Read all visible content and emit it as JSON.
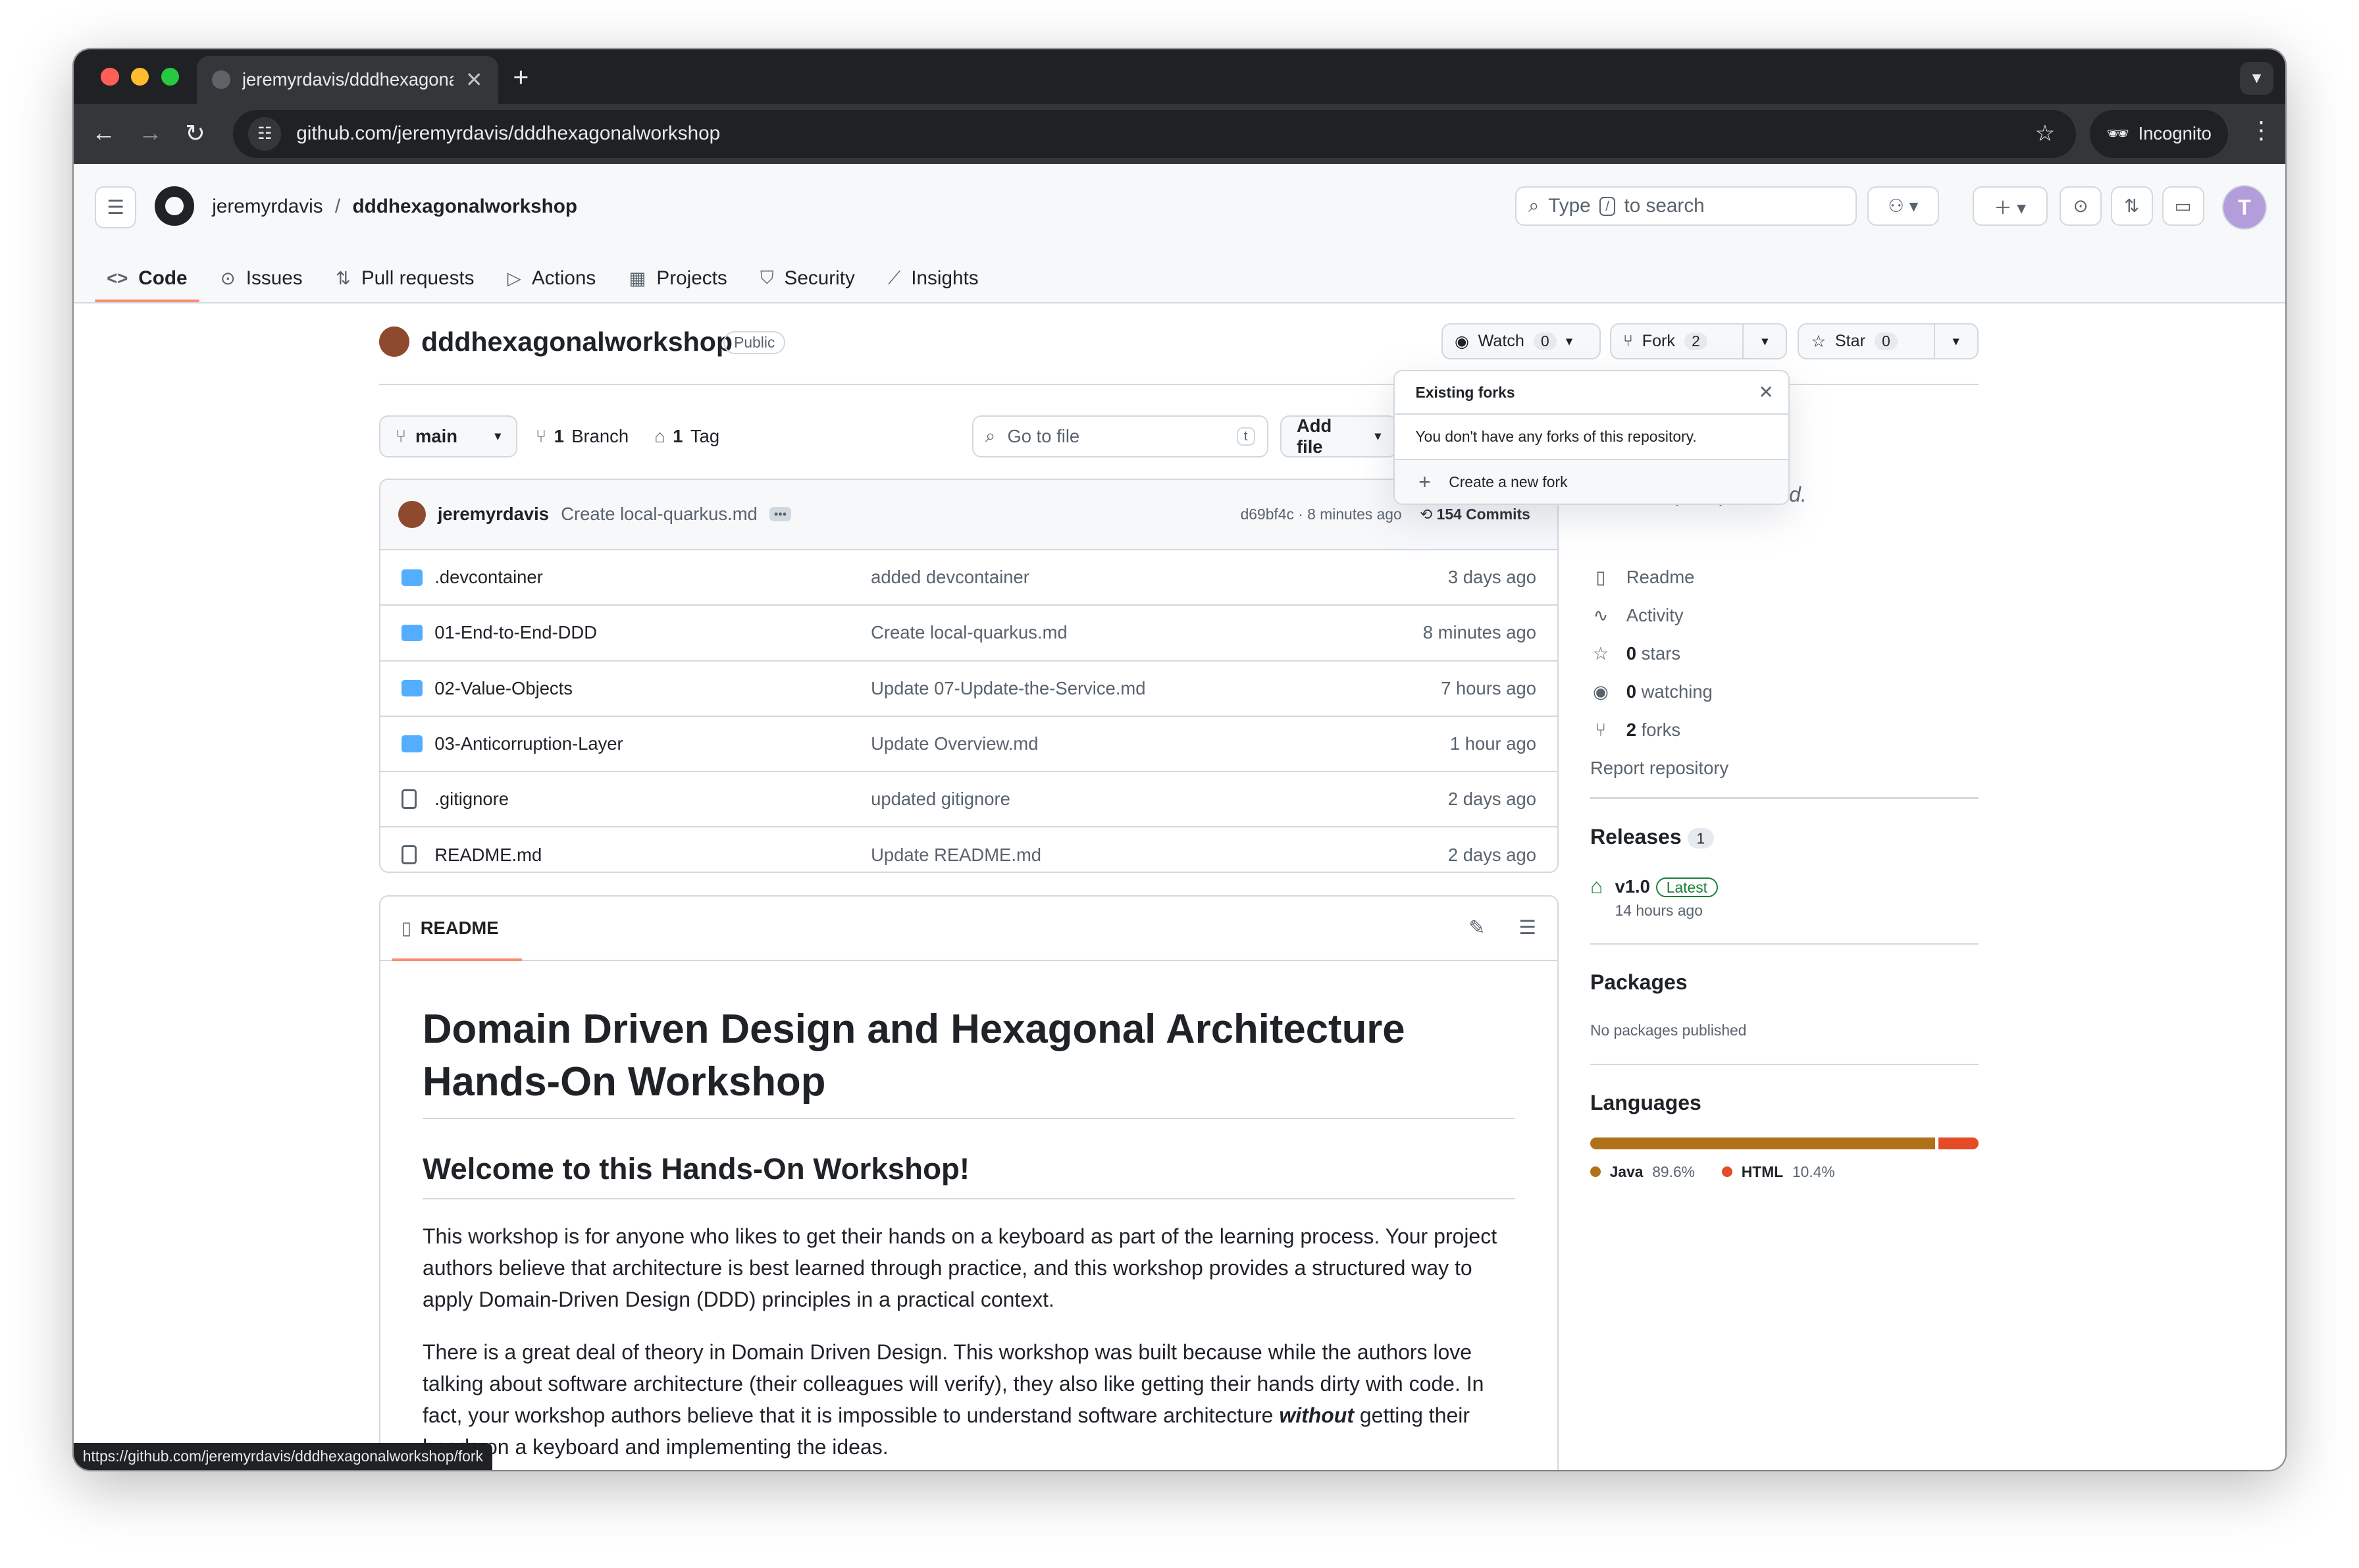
{
  "browser": {
    "tab_title": "jeremyrdavis/dddhexagonalworkshop",
    "url": "github.com/jeremyrdavis/dddhexagonalworkshop",
    "incognito_label": "Incognito",
    "status_url": "https://github.com/jeremyrdavis/dddhexagonalworkshop/fork"
  },
  "header": {
    "owner": "jeremyrdavis",
    "separator": "/",
    "repo": "dddhexagonalworkshop",
    "search_prefix": "Type",
    "search_key": "/",
    "search_suffix": "to search"
  },
  "repo_nav": {
    "code": "Code",
    "issues": "Issues",
    "pulls": "Pull requests",
    "actions": "Actions",
    "projects": "Projects",
    "security": "Security",
    "insights": "Insights"
  },
  "repo": {
    "name": "dddhexagonalworkshop",
    "visibility": "Public",
    "watch_label": "Watch",
    "watch_count": "0",
    "fork_label": "Fork",
    "fork_count": "2",
    "star_label": "Star",
    "star_count": "0"
  },
  "branch": {
    "name": "main",
    "branches_count": "1",
    "branches_label": "Branch",
    "tags_count": "1",
    "tags_label": "Tag",
    "go_to_file": "Go to file",
    "go_to_file_key": "t",
    "add_file": "Add file"
  },
  "latest_commit": {
    "author": "jeremyrdavis",
    "message": "Create local-quarkus.md",
    "sha_time": "d69bf4c · 8 minutes ago",
    "commits": "154 Commits"
  },
  "files": [
    {
      "name": ".devcontainer",
      "message": "added devcontainer",
      "age": "3 days ago",
      "type": "folder"
    },
    {
      "name": "01-End-to-End-DDD",
      "message": "Create local-quarkus.md",
      "age": "8 minutes ago",
      "type": "folder"
    },
    {
      "name": "02-Value-Objects",
      "message": "Update 07-Update-the-Service.md",
      "age": "7 hours ago",
      "type": "folder"
    },
    {
      "name": "03-Anticorruption-Layer",
      "message": "Update Overview.md",
      "age": "1 hour ago",
      "type": "folder"
    },
    {
      "name": ".gitignore",
      "message": "updated gitignore",
      "age": "2 days ago",
      "type": "file"
    },
    {
      "name": "README.md",
      "message": "Update README.md",
      "age": "2 days ago",
      "type": "file"
    }
  ],
  "readme": {
    "tab_label": "README",
    "h1": "Domain Driven Design and Hexagonal Architecture Hands-On Workshop",
    "h2": "Welcome to this Hands-On Workshop!",
    "p1": "This workshop is for anyone who likes to get their hands on a keyboard as part of the learning process. Your project authors believe that architecture is best learned through practice, and this workshop provides a structured way to apply Domain-Driven Design (DDD) principles in a practical context.",
    "p2_a": "There is a great deal of theory in Domain Driven Design. This workshop was built because while the authors love talking about software architecture (their colleagues will verify), they also like getting their hands dirty with code. In fact, your workshop authors believe that it is impossible to understand software architecture ",
    "p2_em": "without",
    "p2_b": " getting their hands on a keyboard and implementing the ideas."
  },
  "sidebar": {
    "about_tail": "site, or topics provided.",
    "links": [
      {
        "icon": "book-icon",
        "count": "",
        "label": "Readme"
      },
      {
        "icon": "pulse-icon",
        "count": "",
        "label": "Activity"
      },
      {
        "icon": "star-icon",
        "count": "0",
        "label": "stars"
      },
      {
        "icon": "eye-icon",
        "count": "0",
        "label": "watching"
      },
      {
        "icon": "fork-icon",
        "count": "2",
        "label": "forks"
      }
    ],
    "report": "Report repository",
    "releases_title": "Releases",
    "releases_count": "1",
    "release_version": "v1.0",
    "release_badge": "Latest",
    "release_time": "14 hours ago",
    "packages_title": "Packages",
    "packages_empty": "No packages published",
    "languages_title": "Languages",
    "languages": [
      {
        "name": "Java",
        "percent": "89.6%",
        "value": 89.6,
        "color": "#b07219"
      },
      {
        "name": "HTML",
        "percent": "10.4%",
        "value": 10.4,
        "color": "#e34c26"
      }
    ]
  },
  "fork_popover": {
    "title": "Existing forks",
    "empty": "You don't have any forks of this repository.",
    "create": "Create a new fork"
  }
}
